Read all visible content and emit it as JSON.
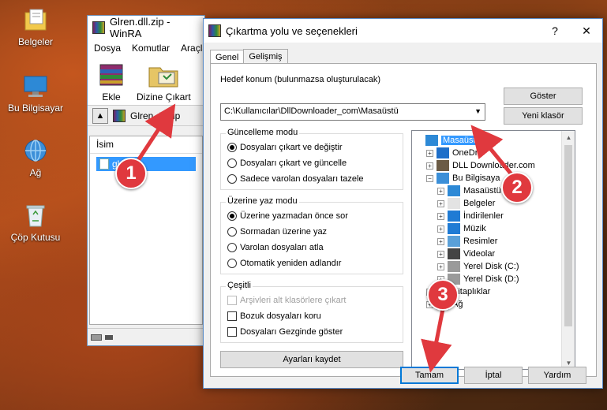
{
  "desktop": {
    "icons": [
      {
        "label": "Belgeler",
        "icon": "folder-documents-icon"
      },
      {
        "label": "Bu Bilgisayar",
        "icon": "computer-icon"
      },
      {
        "label": "Ağ",
        "icon": "network-icon"
      },
      {
        "label": "Çöp Kutusu",
        "icon": "recycle-bin-icon"
      }
    ]
  },
  "winrar": {
    "title": "Glren.dll.zip - WinRA",
    "menu": [
      "Dosya",
      "Komutlar",
      "Araçla"
    ],
    "toolbar": {
      "extract_label": "Ekle",
      "extract_to_label": "Dizine Çıkart"
    },
    "address": "Glren.dll.zip",
    "list_header": "İsim",
    "file_name": "gl...dll"
  },
  "dialog": {
    "title": "Çıkartma yolu ve seçenekleri",
    "help_glyph": "?",
    "close_glyph": "✕",
    "tabs": [
      "Genel",
      "Gelişmiş"
    ],
    "destination_label": "Hedef konum (bulunmazsa oluşturulacak)",
    "destination_value": "C:\\Kullanıcılar\\DllDownloader_com\\Masaüstü",
    "show_button": "Göster",
    "new_folder_button": "Yeni klasör",
    "update_mode": {
      "title": "Güncelleme modu",
      "options": [
        "Dosyaları çıkart ve değiştir",
        "Dosyaları çıkart ve güncelle",
        "Sadece varolan dosyaları tazele"
      ],
      "selected": 0
    },
    "overwrite_mode": {
      "title": "Üzerine yaz modu",
      "options": [
        "Üzerine yazmadan önce sor",
        "Sormadan üzerine yaz",
        "Varolan dosyaları atla",
        "Otomatik yeniden adlandır"
      ],
      "selected": 0
    },
    "misc": {
      "title": "Çeşitli",
      "options": [
        {
          "label": "Arşivleri alt klasörlere çıkart",
          "checked": false,
          "disabled": true
        },
        {
          "label": "Bozuk dosyaları koru",
          "checked": false,
          "disabled": false
        },
        {
          "label": "Dosyaları Gezginde göster",
          "checked": false,
          "disabled": false
        }
      ]
    },
    "save_settings_button": "Ayarları kaydet",
    "tree": [
      {
        "label": "Masaüstü",
        "level": 0,
        "icon": "desktop-icon",
        "selected": true,
        "expander": ""
      },
      {
        "label": "OneDri",
        "level": 1,
        "icon": "onedrive-icon",
        "selected": false,
        "expander": "+"
      },
      {
        "label": "DLL Downloader.com",
        "level": 1,
        "icon": "user-icon",
        "selected": false,
        "expander": "+"
      },
      {
        "label": "Bu Bilgisaya",
        "level": 1,
        "icon": "computer-icon",
        "selected": false,
        "expander": "−"
      },
      {
        "label": "Masaüstü",
        "level": 2,
        "icon": "desktop-icon",
        "selected": false,
        "expander": "+"
      },
      {
        "label": "Belgeler",
        "level": 2,
        "icon": "documents-icon",
        "selected": false,
        "expander": "+"
      },
      {
        "label": "İndirilenler",
        "level": 2,
        "icon": "downloads-icon",
        "selected": false,
        "expander": "+"
      },
      {
        "label": "Müzik",
        "level": 2,
        "icon": "music-icon",
        "selected": false,
        "expander": "+"
      },
      {
        "label": "Resimler",
        "level": 2,
        "icon": "pictures-icon",
        "selected": false,
        "expander": "+"
      },
      {
        "label": "Videolar",
        "level": 2,
        "icon": "videos-icon",
        "selected": false,
        "expander": "+"
      },
      {
        "label": "Yerel Disk (C:)",
        "level": 2,
        "icon": "drive-icon",
        "selected": false,
        "expander": "+"
      },
      {
        "label": "Yerel Disk (D:)",
        "level": 2,
        "icon": "drive-icon",
        "selected": false,
        "expander": "+"
      },
      {
        "label": "Kitaplıklar",
        "level": 1,
        "icon": "libraries-icon",
        "selected": false,
        "expander": "+"
      },
      {
        "label": "Ağ",
        "level": 1,
        "icon": "network-icon",
        "selected": false,
        "expander": "+"
      }
    ],
    "buttons": {
      "ok": "Tamam",
      "cancel": "İptal",
      "help": "Yardım"
    }
  },
  "callouts": [
    "1",
    "2",
    "3"
  ],
  "colors": {
    "callout": "#e0393e",
    "selection": "#3399ff",
    "accent": "#0078d7"
  }
}
